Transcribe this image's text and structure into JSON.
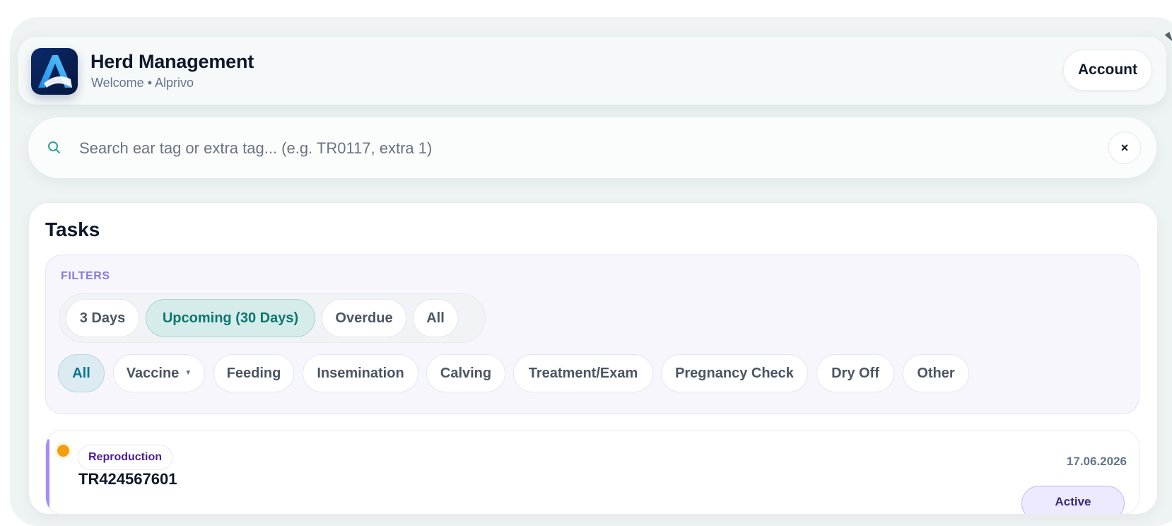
{
  "header": {
    "title": "Herd Management",
    "subtitle": "Welcome • Alprivo",
    "account_label": "Account"
  },
  "search": {
    "placeholder": "Search ear tag or extra tag... (e.g. TR0117, extra 1)",
    "value": "",
    "clear_label": "×"
  },
  "tasks": {
    "title": "Tasks",
    "filters_label": "FILTERS",
    "range_options": [
      {
        "label": "3 Days",
        "active": false
      },
      {
        "label": "Upcoming (30 Days)",
        "active": true
      },
      {
        "label": "Overdue",
        "active": false
      },
      {
        "label": "All",
        "active": false
      }
    ],
    "category_options": [
      {
        "label": "All",
        "active": true
      },
      {
        "label": "Vaccine",
        "active": false,
        "dropdown": true
      },
      {
        "label": "Feeding",
        "active": false
      },
      {
        "label": "Insemination",
        "active": false
      },
      {
        "label": "Calving",
        "active": false
      },
      {
        "label": "Treatment/Exam",
        "active": false
      },
      {
        "label": "Pregnancy Check",
        "active": false
      },
      {
        "label": "Dry Off",
        "active": false
      },
      {
        "label": "Other",
        "active": false
      }
    ],
    "items": [
      {
        "category": "Reproduction",
        "ear_tag": "TR424567601",
        "date": "17.06.2026",
        "status": "Active"
      }
    ]
  },
  "colors": {
    "accent_teal": "#0f766e",
    "filters_label": "#8b7ad8",
    "task_bar": "#a78bfa",
    "task_dot": "#f59e0b"
  },
  "icons": {
    "logo": "app-logo-a",
    "search": "search-icon",
    "clear": "close-icon",
    "dropdown": "caret-down-icon"
  }
}
